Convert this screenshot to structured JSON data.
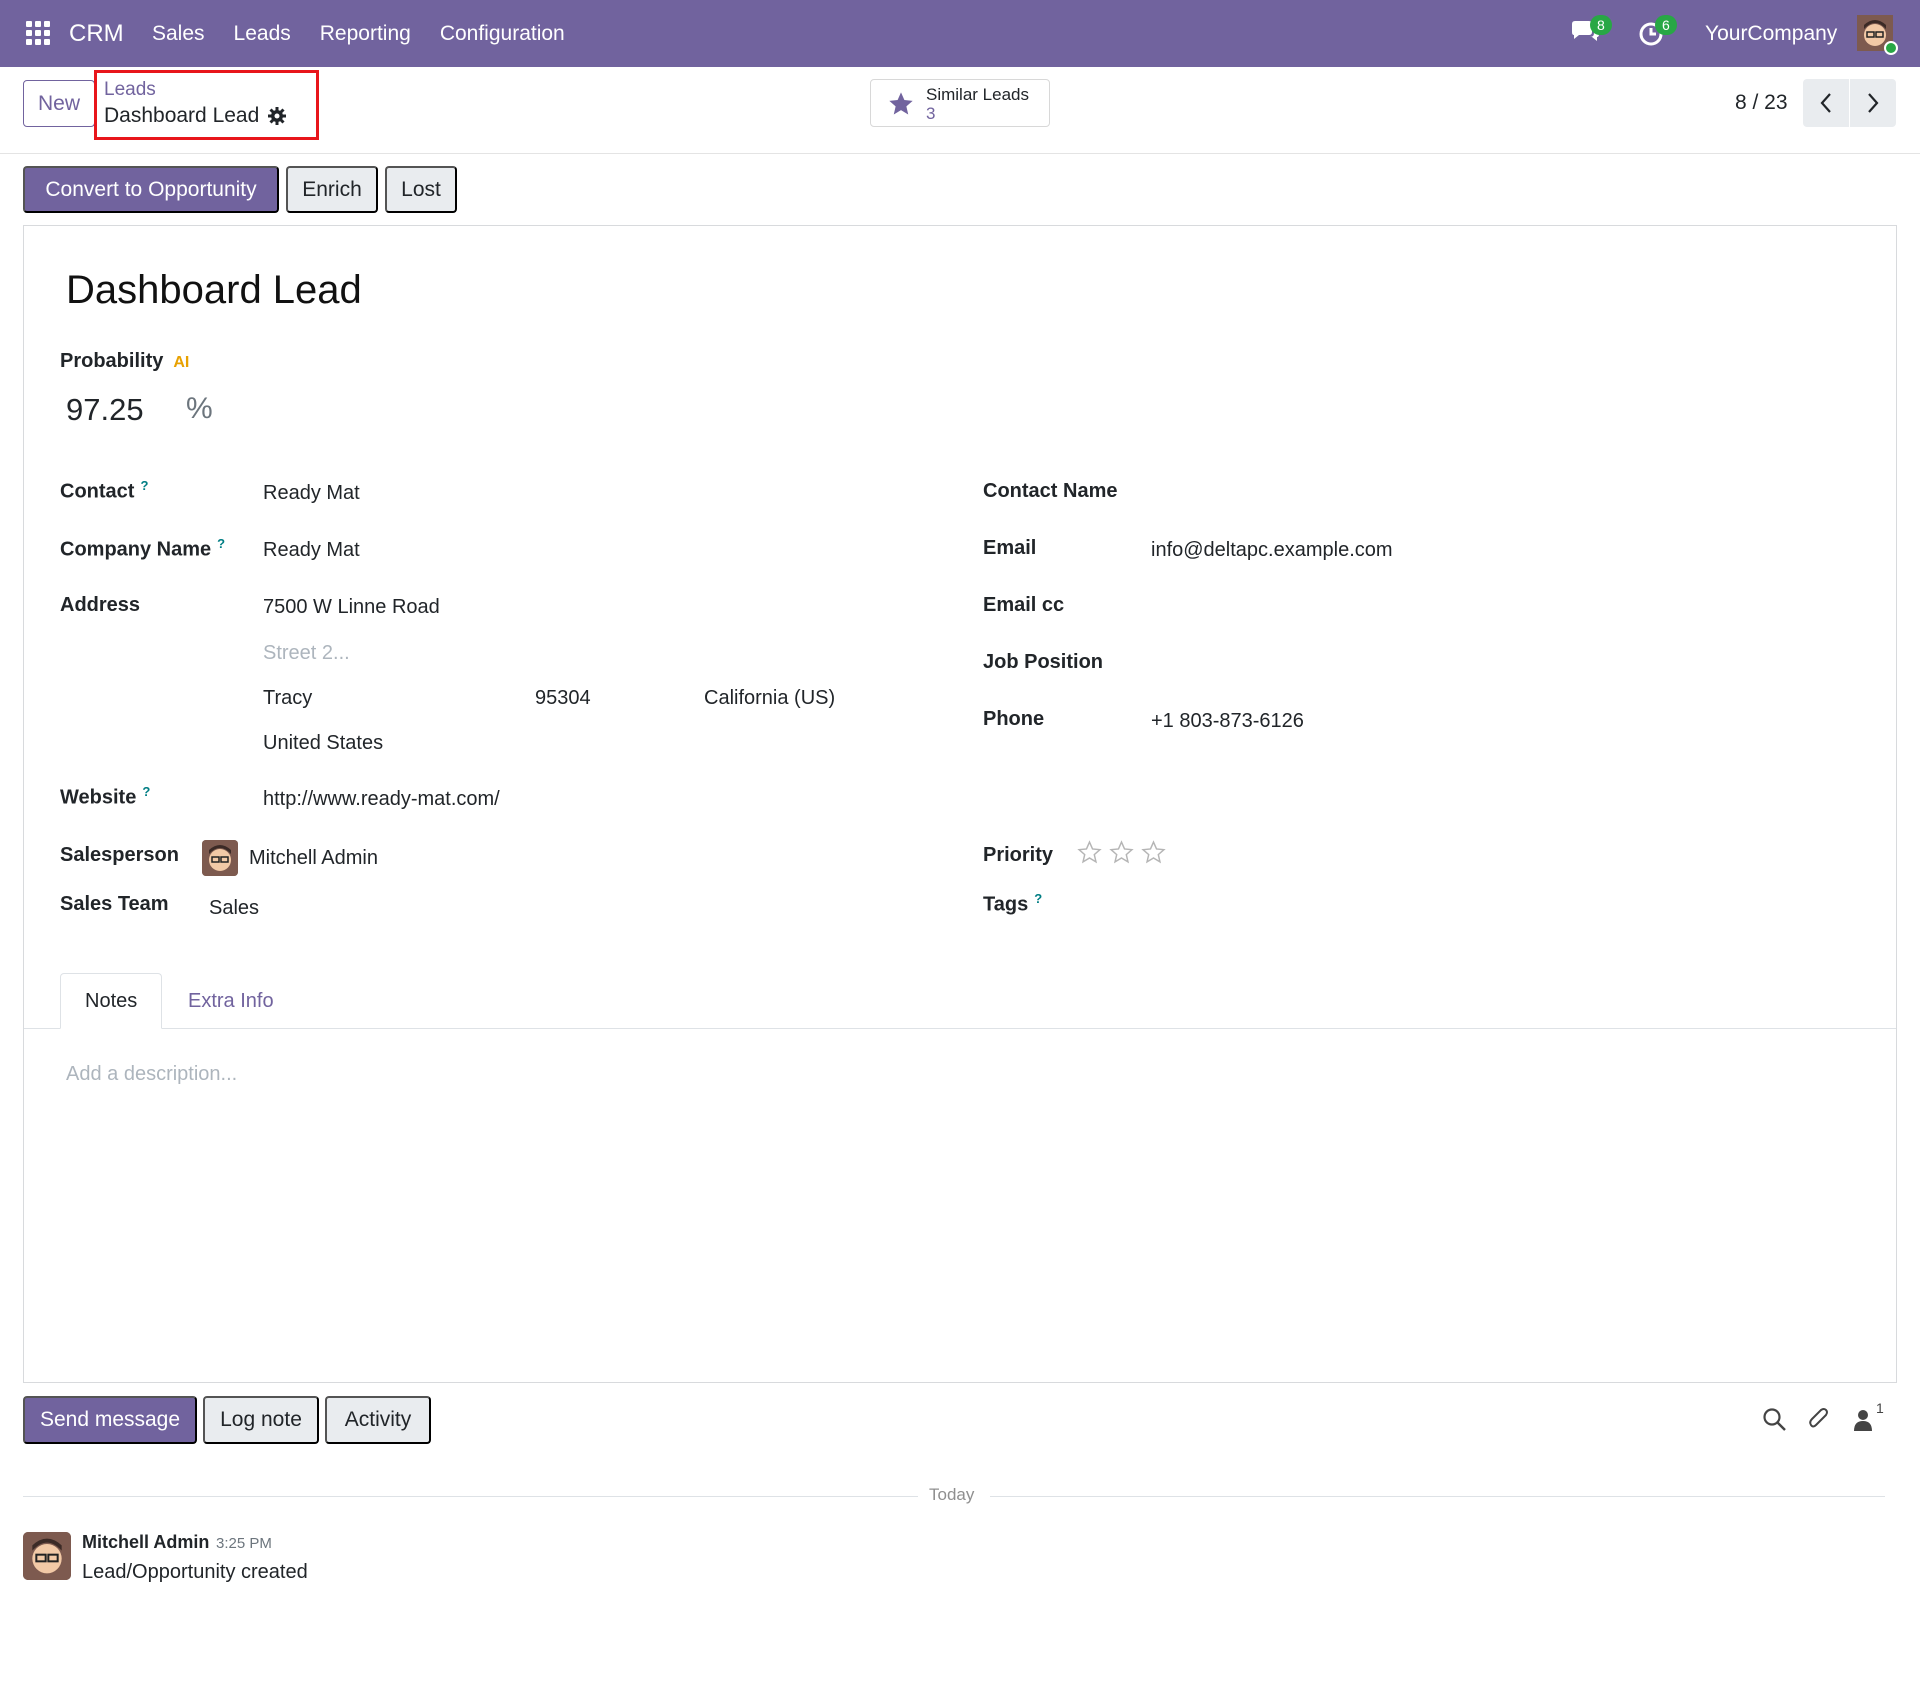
{
  "navbar": {
    "brand": "CRM",
    "menu": [
      "Sales",
      "Leads",
      "Reporting",
      "Configuration"
    ],
    "messages_count": "8",
    "activities_count": "6",
    "company": "YourCompany"
  },
  "control_panel": {
    "new_label": "New",
    "breadcrumb_parent": "Leads",
    "breadcrumb_current": "Dashboard Lead",
    "similar_label": "Similar Leads",
    "similar_count": "3",
    "pager_value": "8 / 23"
  },
  "actions": {
    "convert": "Convert to Opportunity",
    "enrich": "Enrich",
    "lost": "Lost"
  },
  "form": {
    "title": "Dashboard Lead",
    "probability_label": "Probability",
    "probability_ai": "AI",
    "probability_value": "97.25",
    "probability_unit": "%",
    "left": {
      "contact_label": "Contact",
      "contact_value": "Ready Mat",
      "company_label": "Company Name",
      "company_value": "Ready Mat",
      "address_label": "Address",
      "street": "7500 W Linne Road",
      "street2_placeholder": "Street 2...",
      "city": "Tracy",
      "zip": "95304",
      "state": "California (US)",
      "country": "United States",
      "website_label": "Website",
      "website_value": "http://www.ready-mat.com/",
      "salesperson_label": "Salesperson",
      "salesperson_value": "Mitchell Admin",
      "team_label": "Sales Team",
      "team_value": "Sales"
    },
    "right": {
      "contact_name_label": "Contact Name",
      "email_label": "Email",
      "email_value": "info@deltapc.example.com",
      "email_cc_label": "Email cc",
      "job_label": "Job Position",
      "phone_label": "Phone",
      "phone_value": "+1 803-873-6126",
      "priority_label": "Priority",
      "priority_value": 0,
      "tags_label": "Tags"
    },
    "help_mark": "?",
    "tabs": [
      "Notes",
      "Extra Info"
    ],
    "description_placeholder": "Add a description..."
  },
  "chatter": {
    "send_message": "Send message",
    "log_note": "Log note",
    "activity": "Activity",
    "followers_count": "1",
    "date_separator": "Today",
    "message": {
      "author": "Mitchell Admin",
      "time": "3:25 PM",
      "body": "Lead/Opportunity created"
    }
  },
  "colors": {
    "brand": "#71639e",
    "highlight_box": "#e8161b",
    "badge": "#28a745"
  }
}
